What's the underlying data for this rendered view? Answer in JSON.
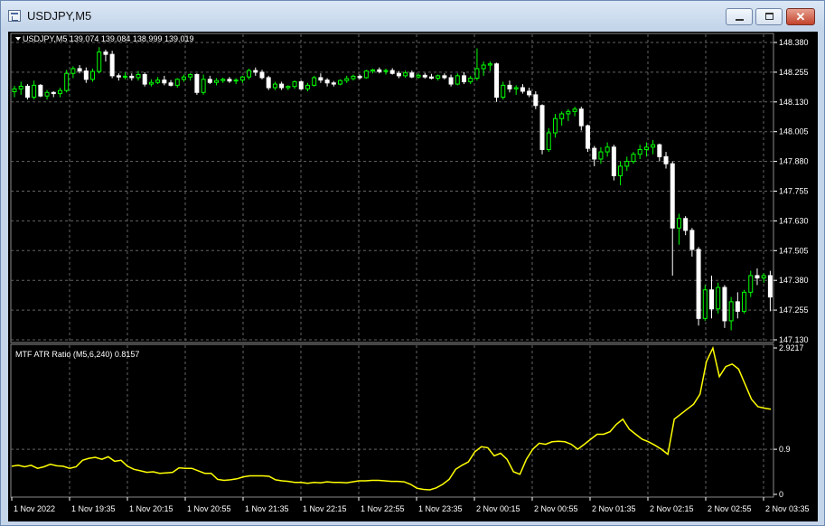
{
  "window": {
    "title": "USDJPY,M5"
  },
  "chart": {
    "symbol_header": "USDJPY,M5  139.074 139.084 138.999 139.019",
    "indicator_header": "MTF ATR Ratio  (M5,6,240) 0.8157",
    "colors": {
      "background": "#000000",
      "bull": "#00ff00",
      "bear": "#ffffff",
      "grid": "#646464",
      "indicator": "#ffff00"
    }
  },
  "chart_data": [
    {
      "type": "candlestick",
      "title": "",
      "ylim": [
        147.13,
        148.38
      ],
      "yticks": [
        "148.380",
        "148.255",
        "148.130",
        "148.005",
        "147.880",
        "147.755",
        "147.630",
        "147.505",
        "147.380",
        "147.255",
        "147.130"
      ],
      "series": [
        {
          "values": [
            [
              148.173,
              148.198,
              148.15,
              148.185
            ],
            [
              148.185,
              148.215,
              148.16,
              148.196
            ],
            [
              148.196,
              148.205,
              148.14,
              148.15
            ],
            [
              148.15,
              148.22,
              148.14,
              148.2
            ],
            [
              148.2,
              148.205,
              148.15,
              148.155
            ],
            [
              148.155,
              148.18,
              148.14,
              148.17
            ],
            [
              148.17,
              148.175,
              148.15,
              148.165
            ],
            [
              148.165,
              148.19,
              148.15,
              148.178
            ],
            [
              148.178,
              148.265,
              148.17,
              148.25
            ],
            [
              148.25,
              148.28,
              148.23,
              148.27
            ],
            [
              148.27,
              148.285,
              148.25,
              148.26
            ],
            [
              148.26,
              148.275,
              148.21,
              148.225
            ],
            [
              148.225,
              148.27,
              148.215,
              148.258
            ],
            [
              148.258,
              148.36,
              148.25,
              148.34
            ],
            [
              148.34,
              148.35,
              148.3,
              148.33
            ],
            [
              148.33,
              148.345,
              148.23,
              148.24
            ],
            [
              148.24,
              148.25,
              148.22,
              148.235
            ],
            [
              148.235,
              148.255,
              148.225,
              148.238
            ],
            [
              148.238,
              148.25,
              148.22,
              148.232
            ],
            [
              148.232,
              148.26,
              148.22,
              148.245
            ],
            [
              148.245,
              148.255,
              148.195,
              148.205
            ],
            [
              148.205,
              148.225,
              148.195,
              148.212
            ],
            [
              148.212,
              148.235,
              148.205,
              148.222
            ],
            [
              148.222,
              148.24,
              148.2,
              148.21
            ],
            [
              148.21,
              148.222,
              148.195,
              148.2
            ],
            [
              148.2,
              148.23,
              148.19,
              148.225
            ],
            [
              148.225,
              148.245,
              148.215,
              148.235
            ],
            [
              148.235,
              148.25,
              148.22,
              148.245
            ],
            [
              148.245,
              148.25,
              148.16,
              148.17
            ],
            [
              148.17,
              148.245,
              148.16,
              148.225
            ],
            [
              148.225,
              148.24,
              148.205,
              148.212
            ],
            [
              148.212,
              148.23,
              148.2,
              148.22
            ],
            [
              148.22,
              148.232,
              148.21,
              148.225
            ],
            [
              148.225,
              148.235,
              148.21,
              148.218
            ],
            [
              148.218,
              148.23,
              148.205,
              148.222
            ],
            [
              148.222,
              148.24,
              148.21,
              148.235
            ],
            [
              148.235,
              148.27,
              148.225,
              148.262
            ],
            [
              148.262,
              148.275,
              148.24,
              148.255
            ],
            [
              148.255,
              148.265,
              148.225,
              148.232
            ],
            [
              148.232,
              148.24,
              148.18,
              148.19
            ],
            [
              148.19,
              148.215,
              148.18,
              148.205
            ],
            [
              148.205,
              148.215,
              148.18,
              148.19
            ],
            [
              148.19,
              148.2,
              148.18,
              148.195
            ],
            [
              148.195,
              148.22,
              148.185,
              148.215
            ],
            [
              148.215,
              148.22,
              148.18,
              148.185
            ],
            [
              148.185,
              148.21,
              148.175,
              148.2
            ],
            [
              148.2,
              148.24,
              148.195,
              148.232
            ],
            [
              148.232,
              148.25,
              148.21,
              148.222
            ],
            [
              148.222,
              148.23,
              148.195,
              148.21
            ],
            [
              148.21,
              148.218,
              148.195,
              148.205
            ],
            [
              148.205,
              148.225,
              148.2,
              148.22
            ],
            [
              148.22,
              148.24,
              148.21,
              148.228
            ],
            [
              148.228,
              148.245,
              148.22,
              148.238
            ],
            [
              148.238,
              148.245,
              148.225,
              148.232
            ],
            [
              148.232,
              148.265,
              148.228,
              148.26
            ],
            [
              148.26,
              148.27,
              148.25,
              148.265
            ],
            [
              148.265,
              148.275,
              148.25,
              148.258
            ],
            [
              148.258,
              148.27,
              148.245,
              148.262
            ],
            [
              148.262,
              148.272,
              148.245,
              148.25
            ],
            [
              148.25,
              148.26,
              148.23,
              148.24
            ],
            [
              148.24,
              148.262,
              148.232,
              148.252
            ],
            [
              148.252,
              148.262,
              148.23,
              148.235
            ],
            [
              148.235,
              148.25,
              148.228,
              148.242
            ],
            [
              148.242,
              148.252,
              148.228,
              148.235
            ],
            [
              148.235,
              148.248,
              148.225,
              148.23
            ],
            [
              148.23,
              148.245,
              148.22,
              148.24
            ],
            [
              148.24,
              148.25,
              148.225,
              148.232
            ],
            [
              148.232,
              148.245,
              148.195,
              148.205
            ],
            [
              148.205,
              148.25,
              148.2,
              148.24
            ],
            [
              148.24,
              148.255,
              148.205,
              148.215
            ],
            [
              148.215,
              148.24,
              148.205,
              148.23
            ],
            [
              148.23,
              148.355,
              148.22,
              148.27
            ],
            [
              148.27,
              148.3,
              148.24,
              148.285
            ],
            [
              148.285,
              148.3,
              148.26,
              148.29
            ],
            [
              148.29,
              148.295,
              148.13,
              148.15
            ],
            [
              148.15,
              148.215,
              148.14,
              148.2
            ],
            [
              148.2,
              148.22,
              148.17,
              148.185
            ],
            [
              148.185,
              148.2,
              148.16,
              148.19
            ],
            [
              148.19,
              148.205,
              148.165,
              148.175
            ],
            [
              148.175,
              148.19,
              148.15,
              148.16
            ],
            [
              148.16,
              148.175,
              148.1,
              148.115
            ],
            [
              148.115,
              148.12,
              147.91,
              147.93
            ],
            [
              147.93,
              148.02,
              147.92,
              148.0
            ],
            [
              148.0,
              148.08,
              147.98,
              148.06
            ],
            [
              148.06,
              148.09,
              148.03,
              148.08
            ],
            [
              148.08,
              148.1,
              148.05,
              148.09
            ],
            [
              148.09,
              148.11,
              148.07,
              148.1
            ],
            [
              148.1,
              148.11,
              148.01,
              148.03
            ],
            [
              148.03,
              148.035,
              147.92,
              147.935
            ],
            [
              147.935,
              147.945,
              147.86,
              147.89
            ],
            [
              147.89,
              147.94,
              147.87,
              147.92
            ],
            [
              147.92,
              147.96,
              147.9,
              147.94
            ],
            [
              147.94,
              147.95,
              147.8,
              147.82
            ],
            [
              147.82,
              147.88,
              147.78,
              147.86
            ],
            [
              147.86,
              147.9,
              147.84,
              147.88
            ],
            [
              147.88,
              147.92,
              147.87,
              147.91
            ],
            [
              147.91,
              147.95,
              147.89,
              147.93
            ],
            [
              147.93,
              147.96,
              147.9,
              147.94
            ],
            [
              147.94,
              147.97,
              147.91,
              147.95
            ],
            [
              147.95,
              147.955,
              147.88,
              147.9
            ],
            [
              147.9,
              147.92,
              147.85,
              147.87
            ],
            [
              147.87,
              147.88,
              147.4,
              147.6
            ],
            [
              147.6,
              147.66,
              147.53,
              147.64
            ],
            [
              147.64,
              147.65,
              147.57,
              147.59
            ],
            [
              147.59,
              147.6,
              147.48,
              147.51
            ],
            [
              147.51,
              147.52,
              147.19,
              147.22
            ],
            [
              147.22,
              147.36,
              147.21,
              147.34
            ],
            [
              147.34,
              147.4,
              147.22,
              147.26
            ],
            [
              147.26,
              147.37,
              147.24,
              147.35
            ],
            [
              147.35,
              147.36,
              147.18,
              147.21
            ],
            [
              147.21,
              147.31,
              147.17,
              147.29
            ],
            [
              147.29,
              147.33,
              147.22,
              147.25
            ],
            [
              147.25,
              147.34,
              147.24,
              147.33
            ],
            [
              147.33,
              147.42,
              147.31,
              147.4
            ],
            [
              147.4,
              147.43,
              147.36,
              147.39
            ],
            [
              147.39,
              147.41,
              147.37,
              147.4
            ],
            [
              147.4,
              147.42,
              147.25,
              147.31
            ]
          ]
        }
      ],
      "xlabels": [
        "1 Nov 2022",
        "1 Nov 19:35",
        "1 Nov 20:15",
        "1 Nov 20:55",
        "1 Nov 21:35",
        "1 Nov 22:15",
        "1 Nov 22:55",
        "1 Nov 23:35",
        "2 Nov 00:15",
        "2 Nov 00:55",
        "2 Nov 01:35",
        "2 Nov 02:15",
        "2 Nov 02:55",
        "2 Nov 03:35"
      ]
    },
    {
      "type": "line",
      "title": "MTF ATR Ratio  (M5,6,240) 0.8157",
      "ylim": [
        0,
        2.9217
      ],
      "yticks": [
        "2.9217",
        "0.9",
        "0"
      ],
      "series": [
        {
          "values": [
            0.56,
            0.58,
            0.55,
            0.58,
            0.52,
            0.55,
            0.6,
            0.57,
            0.56,
            0.52,
            0.55,
            0.68,
            0.72,
            0.74,
            0.7,
            0.75,
            0.66,
            0.68,
            0.56,
            0.5,
            0.47,
            0.44,
            0.45,
            0.42,
            0.43,
            0.44,
            0.53,
            0.52,
            0.52,
            0.47,
            0.42,
            0.42,
            0.3,
            0.28,
            0.29,
            0.31,
            0.35,
            0.37,
            0.37,
            0.37,
            0.36,
            0.29,
            0.27,
            0.26,
            0.24,
            0.24,
            0.22,
            0.24,
            0.23,
            0.25,
            0.24,
            0.24,
            0.23,
            0.25,
            0.27,
            0.27,
            0.28,
            0.28,
            0.27,
            0.26,
            0.26,
            0.25,
            0.2,
            0.12,
            0.1,
            0.09,
            0.13,
            0.2,
            0.3,
            0.5,
            0.58,
            0.65,
            0.85,
            0.95,
            0.93,
            0.77,
            0.82,
            0.7,
            0.45,
            0.4,
            0.7,
            0.9,
            1.02,
            1.0,
            1.05,
            1.06,
            1.05,
            1.0,
            0.9,
            1.0,
            1.1,
            1.2,
            1.2,
            1.25,
            1.4,
            1.5,
            1.3,
            1.2,
            1.1,
            1.05,
            0.98,
            0.9,
            0.8,
            1.5,
            1.6,
            1.7,
            1.8,
            2.0,
            2.65,
            2.92,
            2.35,
            2.55,
            2.6,
            2.5,
            2.2,
            1.9,
            1.75,
            1.72,
            1.7
          ]
        }
      ]
    }
  ]
}
